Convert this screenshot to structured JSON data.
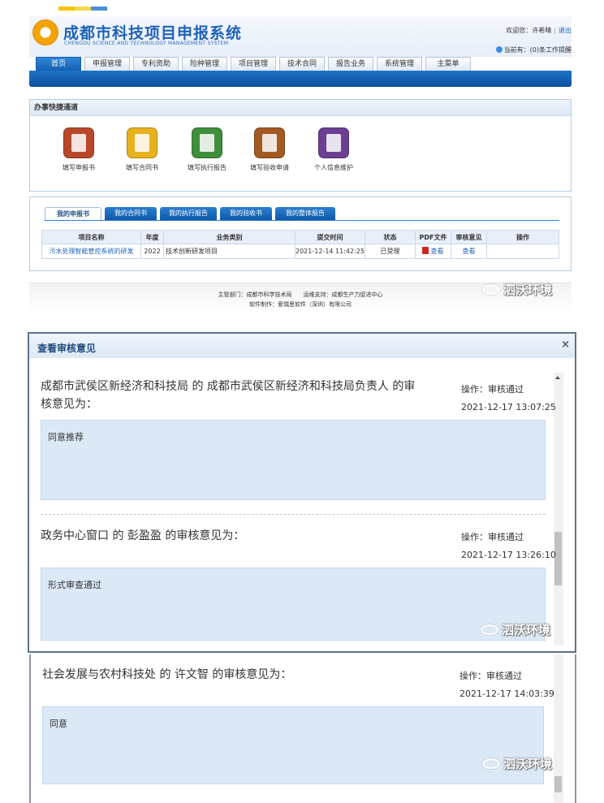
{
  "brand": {
    "title": "成都市科技项目申报系统",
    "subtitle": "CHENGDU SCIENCE AND TECHNOLOGY MANAGEMENT SYSTEM",
    "accent": "#1f62b8",
    "nav_color": "#1560b3"
  },
  "user_bar": {
    "welcome": "欢迎您：许希晴",
    "logout": "退出",
    "notice": "当前有：(0)条工作提醒"
  },
  "nav": [
    "首页",
    "申报管理",
    "专利资助",
    "险种管理",
    "项目管理",
    "技术合同",
    "报告业务",
    "系统管理",
    "主菜单"
  ],
  "quick": {
    "title": "办事快捷通道",
    "items": [
      {
        "label": "填写申报书",
        "color": "#b8482a",
        "icon": "write-application-icon"
      },
      {
        "label": "填写合同书",
        "color": "#e8b21f",
        "icon": "write-contract-icon"
      },
      {
        "label": "填写执行报告",
        "color": "#3f8e3c",
        "icon": "write-report-icon"
      },
      {
        "label": "填写验收申请",
        "color": "#a25a22",
        "icon": "acceptance-icon"
      },
      {
        "label": "个人信息维护",
        "color": "#6b3f92",
        "icon": "profile-icon"
      }
    ]
  },
  "mine": {
    "tabs": [
      "我的申报书",
      "我的合同书",
      "我的执行报告",
      "我的验收书",
      "我的整体报告"
    ],
    "columns": [
      "项目名称",
      "年度",
      "业务类别",
      "提交时间",
      "状态",
      "PDF文件",
      "审核意见",
      "操作"
    ],
    "rows": [
      {
        "name": "污水处理智能管控系统的研发",
        "year": "2022",
        "category": "技术创新研发项目",
        "time": "2021-12-14 11:42:25",
        "status": "已受理",
        "pdf": "查看",
        "review": "查看",
        "op": ""
      }
    ]
  },
  "footer": {
    "line1": "主管部门：成都市科学技术局　　运维支持：成都生产力促进中心",
    "line2": "软件制作：爱瑞思软件（深圳）有限公司"
  },
  "watermark": "泗沃环境",
  "dialog": {
    "title": "查看审核意见",
    "close": "×",
    "entries": [
      {
        "title_line1": "成都市武侯区新经济和科技局 的 成都市武侯区新经济和科技局负责人 的审",
        "title_line2": "核意见为：",
        "action": "操作：审核通过",
        "time": "2021-12-17 13:07:25",
        "opinion": "同意推荐"
      },
      {
        "title_line1": "政务中心窗口 的 彭盈盈 的审核意见为：",
        "action": "操作：审核通过",
        "time": "2021-12-17 13:26:10",
        "opinion": "形式审查通过"
      },
      {
        "title_line1": "社会发展与农村科技处 的 许文智 的审核意见为：",
        "action": "操作：审核通过",
        "time": "2021-12-17 14:03:39",
        "opinion": "同意"
      }
    ]
  }
}
